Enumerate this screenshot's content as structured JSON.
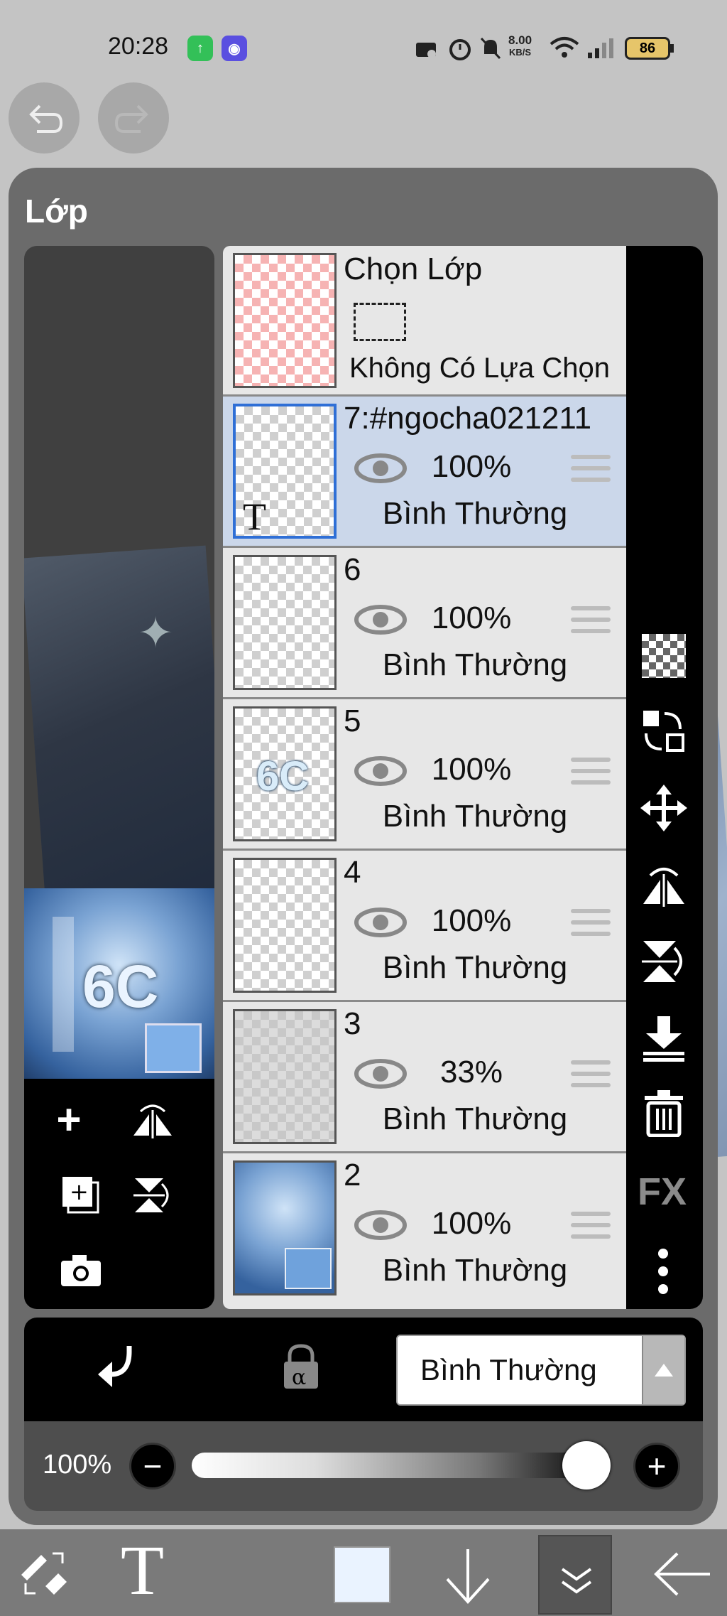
{
  "status_bar": {
    "time": "20:28",
    "network_speed_value": "8.00",
    "network_speed_unit": "KB/S",
    "battery": "86",
    "icons": [
      "upload-app-icon",
      "game-app-icon",
      "nfc-icon",
      "alarm-icon",
      "mute-icon",
      "wifi-icon",
      "signal-icon",
      "battery-icon"
    ]
  },
  "nav": {
    "undo_icon": "undo-icon",
    "redo_icon": "redo-icon"
  },
  "panel": {
    "title": "Lớp"
  },
  "selection_layer": {
    "title": "Chọn Lớp",
    "subtitle": "Không Có Lựa Chọn"
  },
  "layers": [
    {
      "name": "7:#ngocha021211",
      "opacity": "100%",
      "blend": "Bình Thường",
      "selected": true,
      "thumb_glyph": "T"
    },
    {
      "name": "6",
      "opacity": "100%",
      "blend": "Bình Thường",
      "selected": false
    },
    {
      "name": "5",
      "opacity": "100%",
      "blend": "Bình Thường",
      "selected": false,
      "thumb_glyph": "6C"
    },
    {
      "name": "4",
      "opacity": "100%",
      "blend": "Bình Thường",
      "selected": false
    },
    {
      "name": "3",
      "opacity": "33%",
      "blend": "Bình Thường",
      "selected": false
    },
    {
      "name": "2",
      "opacity": "100%",
      "blend": "Bình Thường",
      "selected": false
    }
  ],
  "preview": {
    "text": "6C"
  },
  "right_tools": [
    "transparency-icon",
    "swap-layers-icon",
    "move-icon",
    "flip-horizontal-icon",
    "flip-vertical-icon",
    "merge-down-icon",
    "trash-icon",
    "fx-label",
    "more-icon"
  ],
  "fx_label": "FX",
  "left_tools": [
    "add-layer-icon",
    "flip-layer-icon",
    "duplicate-layer-icon",
    "rotate-layer-icon",
    "camera-icon"
  ],
  "blend_select": {
    "value": "Bình Thường"
  },
  "opacity_slider": {
    "label": "100%",
    "value_fraction": 1.0
  },
  "bottom_toolbar": [
    "brush-eraser-icon",
    "text-tool-icon",
    "color-swatch",
    "down-arrow-icon",
    "collapse-icon",
    "back-arrow-icon"
  ],
  "colors": {
    "panel": "#6b6b6b",
    "selected_row": "#cbd7ea",
    "selection_thumb": "#f6b3b3",
    "swatch": "#eaf3ff"
  }
}
